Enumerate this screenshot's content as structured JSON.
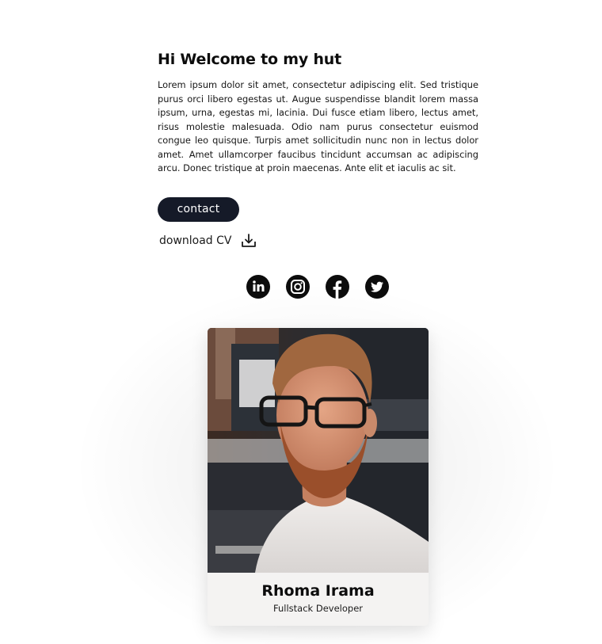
{
  "intro": {
    "heading": "Hi Welcome to my hut",
    "body": "Lorem ipsum dolor sit amet, consectetur adipiscing elit. Sed tristique purus orci libero egestas ut. Augue suspendisse blandit lorem massa ipsum, urna, egestas mi, lacinia. Dui fusce etiam libero, lectus amet, risus molestie malesuada. Odio nam purus consectetur euismod congue leo quisque. Turpis amet sollicitudin nunc non in lectus dolor amet. Amet ullamcorper faucibus tincidunt accumsan ac adipiscing arcu. Donec tristique at proin maecenas. Ante elit et iaculis ac sit."
  },
  "actions": {
    "contact_label": "contact",
    "download_label": "download CV",
    "download_icon": "download-icon"
  },
  "socials": [
    {
      "icon": "linkedin-icon"
    },
    {
      "icon": "instagram-icon"
    },
    {
      "icon": "facebook-icon"
    },
    {
      "icon": "twitter-icon"
    }
  ],
  "profile": {
    "name": "Rhoma Irama",
    "role": "Fullstack Developer"
  },
  "colors": {
    "button_bg": "#151a28",
    "icon_fg": "#0c0c0c",
    "card_bg": "#f4f3f2"
  }
}
